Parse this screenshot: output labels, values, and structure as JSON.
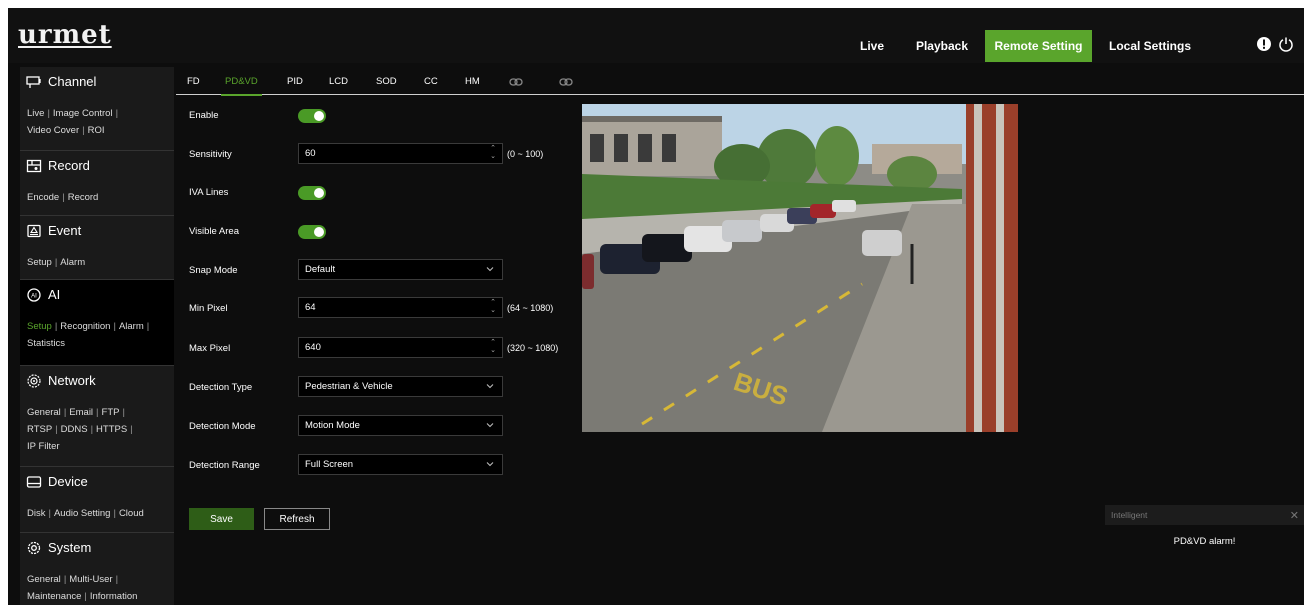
{
  "app": {
    "logo": "urmet"
  },
  "header": {
    "nav": [
      {
        "label": "Live"
      },
      {
        "label": "Playback"
      },
      {
        "label": "Remote Setting",
        "active": true
      },
      {
        "label": "Local Settings"
      }
    ],
    "icons": [
      "alert-icon",
      "power-icon"
    ]
  },
  "sidebar": {
    "sections": [
      {
        "title": "Channel",
        "icon": "channel-icon",
        "links": [
          "Live",
          "Image Control",
          "Video Cover",
          "ROI"
        ]
      },
      {
        "title": "Record",
        "icon": "record-icon",
        "links": [
          "Encode",
          "Record"
        ]
      },
      {
        "title": "Event",
        "icon": "event-icon",
        "links": [
          "Setup",
          "Alarm"
        ]
      },
      {
        "title": "AI",
        "icon": "ai-icon",
        "active": true,
        "active_link": "Setup",
        "links": [
          "Setup",
          "Recognition",
          "Alarm",
          "Statistics"
        ]
      },
      {
        "title": "Network",
        "icon": "network-icon",
        "links": [
          "General",
          "Email",
          "FTP",
          "RTSP",
          "DDNS",
          "HTTPS",
          "IP Filter"
        ]
      },
      {
        "title": "Device",
        "icon": "device-icon",
        "links": [
          "Disk",
          "Audio Setting",
          "Cloud"
        ]
      },
      {
        "title": "System",
        "icon": "system-icon",
        "links": [
          "General",
          "Multi-User",
          "Maintenance",
          "Information"
        ]
      }
    ]
  },
  "tabs": {
    "items": [
      "FD",
      "PD&VD",
      "PID",
      "LCD",
      "SOD",
      "CC",
      "HM"
    ],
    "active": "PD&VD",
    "icon_tabs": [
      "link-icon",
      "link-icon"
    ]
  },
  "form": {
    "enable_label": "Enable",
    "enable_on": true,
    "sensitivity_label": "Sensitivity",
    "sensitivity_value": "60",
    "sensitivity_range": "(0 ~ 100)",
    "iva_lines_label": "IVA Lines",
    "iva_lines_on": true,
    "visible_area_label": "Visible Area",
    "visible_area_on": true,
    "snap_mode_label": "Snap Mode",
    "snap_mode_value": "Default",
    "min_pixel_label": "Min Pixel",
    "min_pixel_value": "64",
    "min_pixel_range": "(64 ~ 1080)",
    "max_pixel_label": "Max Pixel",
    "max_pixel_value": "640",
    "max_pixel_range": "(320 ~ 1080)",
    "detection_type_label": "Detection Type",
    "detection_type_value": "Pedestrian & Vehicle",
    "detection_mode_label": "Detection Mode",
    "detection_mode_value": "Motion Mode",
    "detection_range_label": "Detection Range",
    "detection_range_value": "Full Screen",
    "save_label": "Save",
    "refresh_label": "Refresh"
  },
  "notification": {
    "title": "Intelligent",
    "message": "PD&VD alarm!"
  },
  "colors": {
    "accent": "#5aa52c",
    "background": "#0d0d0d"
  }
}
